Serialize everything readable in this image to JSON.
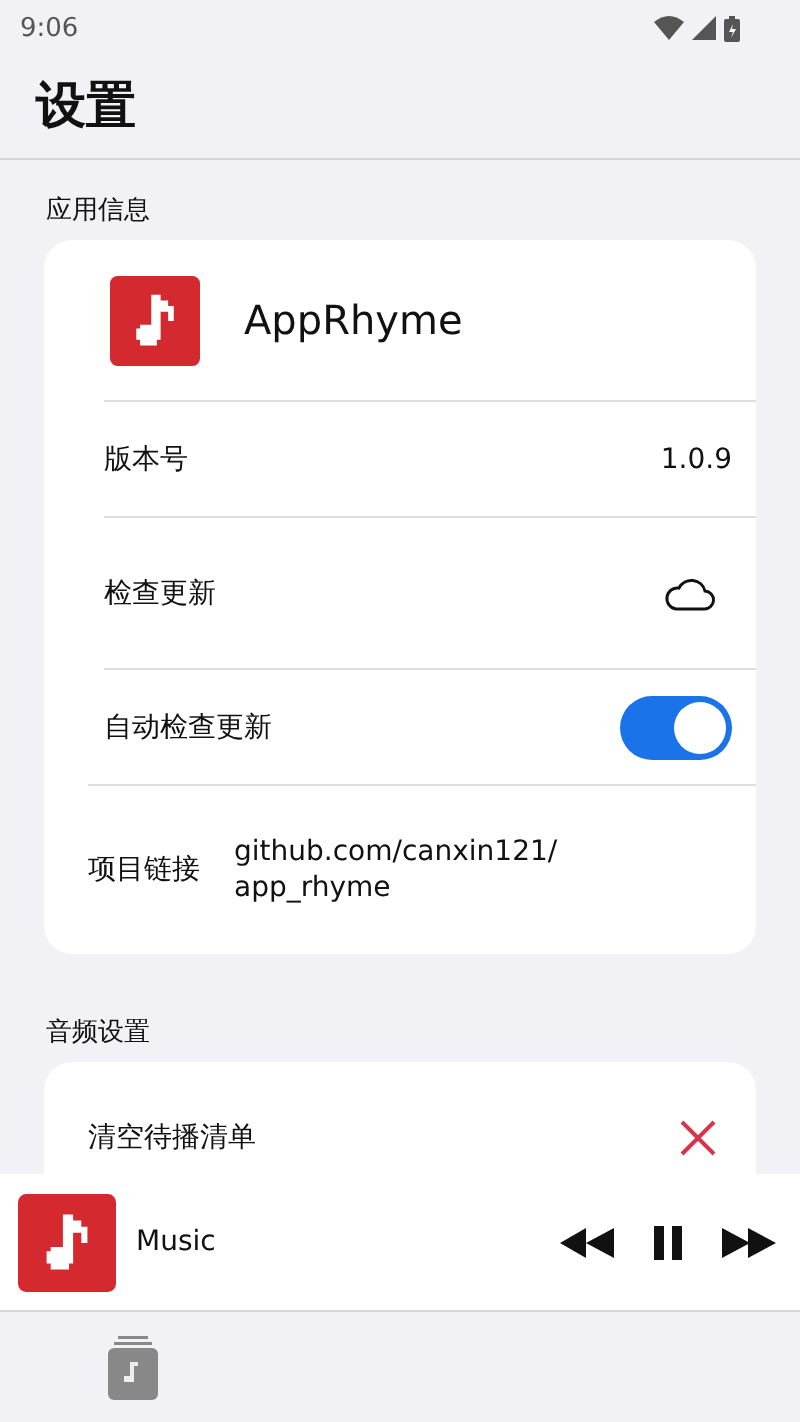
{
  "status_bar": {
    "time": "9:06"
  },
  "title": "设置",
  "sections": [
    {
      "label": "应用信息",
      "rows": [
        {
          "kind": "app",
          "text": "AppRhyme"
        },
        {
          "kind": "value",
          "label": "版本号",
          "value": "1.0.9"
        },
        {
          "kind": "update",
          "label": "检查更新"
        },
        {
          "kind": "toggle",
          "label": "自动检查更新",
          "on": true
        },
        {
          "kind": "link",
          "label": "项目链接",
          "value": "github.com/canxin121/\napp_rhyme"
        }
      ]
    },
    {
      "label": "音频设置",
      "rows": [
        {
          "kind": "clear",
          "label": "清空待播清单"
        }
      ]
    }
  ],
  "player": {
    "title": "Music",
    "playing": true
  }
}
